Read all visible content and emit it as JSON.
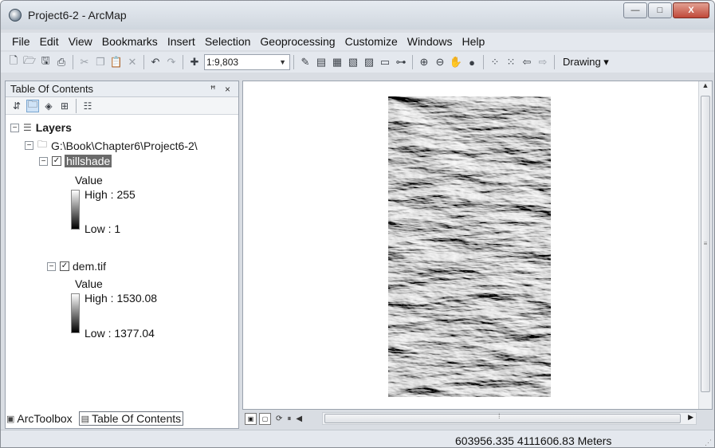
{
  "window": {
    "title": "Project6-2 - ArcMap",
    "min_glyph": "—",
    "max_glyph": "□",
    "close_glyph": "X"
  },
  "menu": [
    "File",
    "Edit",
    "View",
    "Bookmarks",
    "Insert",
    "Selection",
    "Geoprocessing",
    "Customize",
    "Windows",
    "Help"
  ],
  "toolbar": {
    "scale": "1:9,803",
    "drawing_label": "Drawing"
  },
  "toc": {
    "title": "Table Of Contents",
    "header_controls": "ꟸ ×",
    "layers_label": "Layers",
    "folder_path": "G:\\Book\\Chapter6\\Project6-2\\",
    "layers": [
      {
        "name": "hillshade",
        "value_label": "Value",
        "high": "High : 255",
        "low": "Low : 1",
        "checked": true,
        "selected": true
      },
      {
        "name": "dem.tif",
        "value_label": "Value",
        "high": "High : 1530.08",
        "low": "Low : 1377.04",
        "checked": true,
        "selected": false
      }
    ],
    "tabs": [
      {
        "label": "ArcToolbox",
        "icon": "toolbox-icon",
        "active": false
      },
      {
        "label": "Table Of Contents",
        "icon": "table-of-contents-icon",
        "active": true
      }
    ]
  },
  "map": {
    "grip_glyph": "⁞"
  },
  "status": {
    "coordinates": "603956.335  4111606.83 Meters"
  }
}
